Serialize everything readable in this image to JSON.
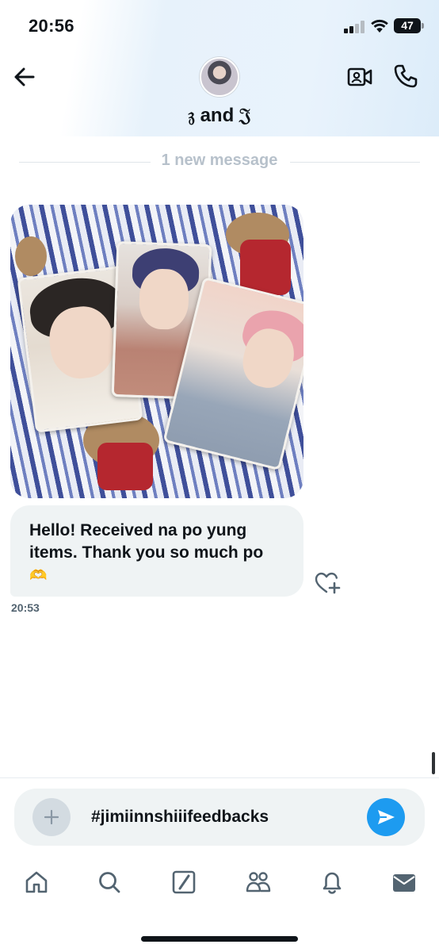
{
  "status_bar": {
    "time": "20:56",
    "battery": "47"
  },
  "header": {
    "title": "𝔷 and 𝔍",
    "back_icon": "arrow-left-icon",
    "video_icon": "video-camera-icon",
    "call_icon": "phone-icon"
  },
  "conversation": {
    "new_message_divider": "1 new message",
    "messages": [
      {
        "type": "image",
        "alt": "photo"
      },
      {
        "type": "text",
        "lines": [
          "Hello! Received na po yung",
          "items. Thank you so much po"
        ],
        "emoji": "🫶",
        "time": "20:53",
        "react_icon": "heart-plus-icon"
      }
    ]
  },
  "composer": {
    "value": "#jimiinnshiiifeedbacks",
    "add_icon": "plus-icon",
    "send_icon": "send-icon"
  },
  "bottom_nav": {
    "items": [
      "home-icon",
      "search-icon",
      "compose-icon",
      "communities-icon",
      "bell-icon",
      "mail-icon"
    ]
  },
  "colors": {
    "accent": "#1d9bf0",
    "bubble": "#eff3f4",
    "text": "#0f1419",
    "muted": "#536471",
    "divider_text": "#b7c1cb"
  }
}
